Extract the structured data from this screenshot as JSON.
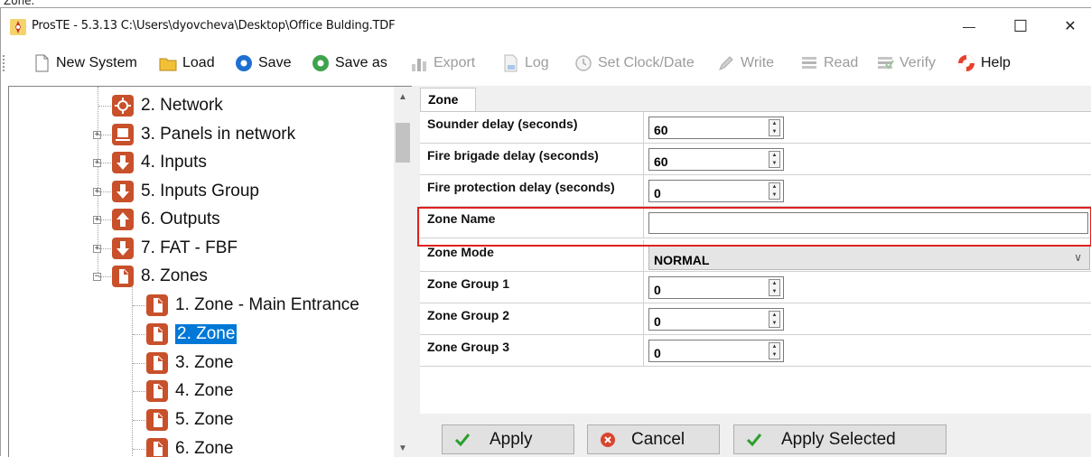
{
  "top_strip_text": "Zone.",
  "window": {
    "title": "ProsTE - 5.3.13 C:\\Users\\dyovcheva\\Desktop\\Office Bulding.TDF",
    "minimize_glyph": "—",
    "maximize_glyph": "☐",
    "close_glyph": "✕"
  },
  "toolbar": {
    "new_system": "New System",
    "load": "Load",
    "save": "Save",
    "save_as": "Save as",
    "export": "Export",
    "log": "Log",
    "set_clock": "Set Clock/Date",
    "write": "Write",
    "read": "Read",
    "verify": "Verify",
    "help": "Help"
  },
  "tree": {
    "items": [
      {
        "label": "2. Network",
        "expander": ""
      },
      {
        "label": "3. Panels in network",
        "expander": "+"
      },
      {
        "label": "4. Inputs",
        "expander": "+"
      },
      {
        "label": "5. Inputs Group",
        "expander": "+"
      },
      {
        "label": "6. Outputs",
        "expander": "+"
      },
      {
        "label": "7. FAT - FBF",
        "expander": "+"
      },
      {
        "label": "8. Zones",
        "expander": "−"
      }
    ],
    "zones": [
      {
        "label": "1. Zone - Main Entrance"
      },
      {
        "label": "2. Zone",
        "selected": true
      },
      {
        "label": "3. Zone"
      },
      {
        "label": "4. Zone"
      },
      {
        "label": "5. Zone"
      },
      {
        "label": "6. Zone"
      }
    ]
  },
  "panel": {
    "tab": "Zone",
    "rows": [
      {
        "label": "Sounder delay (seconds)",
        "value": "60"
      },
      {
        "label": "Fire brigade delay (seconds)",
        "value": "60"
      },
      {
        "label": "Fire protection delay (seconds)",
        "value": "0"
      },
      {
        "label": "Zone Name",
        "value": ""
      },
      {
        "label": "Zone Mode",
        "value": "NORMAL"
      },
      {
        "label": "Zone Group 1",
        "value": "0"
      },
      {
        "label": "Zone Group 2",
        "value": "0"
      },
      {
        "label": "Zone Group 3",
        "value": "0"
      }
    ]
  },
  "buttons": {
    "apply": "Apply",
    "cancel": "Cancel",
    "apply_selected": "Apply Selected"
  },
  "colors": {
    "selection": "#0078d7",
    "highlight_border": "#e02020",
    "tree_icon": "#c8502a",
    "check_green": "#2ca02c",
    "cancel_red": "#d9442f"
  }
}
